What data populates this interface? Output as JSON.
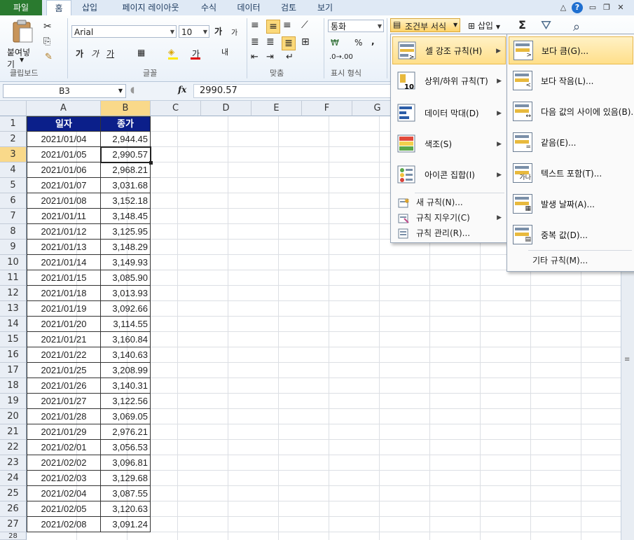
{
  "tabs": [
    "파일",
    "홈",
    "삽입",
    "페이지 레이아웃",
    "수식",
    "데이터",
    "검토",
    "보기"
  ],
  "ribbon": {
    "paste_label": "붙여넣기",
    "font_name": "Arial",
    "font_size": "10",
    "increase_font": "가",
    "decrease_font": "가",
    "bold": "가",
    "italic": "가",
    "underline": "가",
    "wrap": "내",
    "number_format": "통화",
    "percent": "%",
    "comma": ",",
    "conditional_format": "조건부 서식",
    "insert": "삽입",
    "sum": "Σ",
    "groups": {
      "clipboard": "클립보드",
      "font": "글꼴",
      "align": "맞춤",
      "number": "표시 형식"
    }
  },
  "formula_bar": {
    "name_box": "B3",
    "fx": "fx",
    "value": "2990.57"
  },
  "columns": [
    "A",
    "B",
    "C",
    "D",
    "E",
    "F",
    "G"
  ],
  "header_row": {
    "a": "일자",
    "b": "종가"
  },
  "rows": [
    {
      "n": "2",
      "date": "2021/01/04",
      "close": "2,944.45"
    },
    {
      "n": "3",
      "date": "2021/01/05",
      "close": "2,990.57"
    },
    {
      "n": "4",
      "date": "2021/01/06",
      "close": "2,968.21"
    },
    {
      "n": "5",
      "date": "2021/01/07",
      "close": "3,031.68"
    },
    {
      "n": "6",
      "date": "2021/01/08",
      "close": "3,152.18"
    },
    {
      "n": "7",
      "date": "2021/01/11",
      "close": "3,148.45"
    },
    {
      "n": "8",
      "date": "2021/01/12",
      "close": "3,125.95"
    },
    {
      "n": "9",
      "date": "2021/01/13",
      "close": "3,148.29"
    },
    {
      "n": "10",
      "date": "2021/01/14",
      "close": "3,149.93"
    },
    {
      "n": "11",
      "date": "2021/01/15",
      "close": "3,085.90"
    },
    {
      "n": "12",
      "date": "2021/01/18",
      "close": "3,013.93"
    },
    {
      "n": "13",
      "date": "2021/01/19",
      "close": "3,092.66"
    },
    {
      "n": "14",
      "date": "2021/01/20",
      "close": "3,114.55"
    },
    {
      "n": "15",
      "date": "2021/01/21",
      "close": "3,160.84"
    },
    {
      "n": "16",
      "date": "2021/01/22",
      "close": "3,140.63"
    },
    {
      "n": "17",
      "date": "2021/01/25",
      "close": "3,208.99"
    },
    {
      "n": "18",
      "date": "2021/01/26",
      "close": "3,140.31"
    },
    {
      "n": "19",
      "date": "2021/01/27",
      "close": "3,122.56"
    },
    {
      "n": "20",
      "date": "2021/01/28",
      "close": "3,069.05"
    },
    {
      "n": "21",
      "date": "2021/01/29",
      "close": "2,976.21"
    },
    {
      "n": "22",
      "date": "2021/02/01",
      "close": "3,056.53"
    },
    {
      "n": "23",
      "date": "2021/02/02",
      "close": "3,096.81"
    },
    {
      "n": "24",
      "date": "2021/02/03",
      "close": "3,129.68"
    },
    {
      "n": "25",
      "date": "2021/02/04",
      "close": "3,087.55"
    },
    {
      "n": "26",
      "date": "2021/02/05",
      "close": "3,120.63"
    },
    {
      "n": "27",
      "date": "2021/02/08",
      "close": "3,091.24"
    }
  ],
  "last_row_number": "28",
  "menu_main": [
    "셀 강조 규칙(H)",
    "상위/하위 규칙(T)",
    "데이터 막대(D)",
    "색조(S)",
    "아이콘 집합(I)"
  ],
  "menu_small": [
    "새 규칙(N)...",
    "규칙 지우기(C)",
    "규칙 관리(R)..."
  ],
  "submenu": [
    "보다 큼(G)...",
    "보다 작음(L)...",
    "다음 값의 사이에 있음(B)...",
    "같음(E)...",
    "텍스트 포함(T)...",
    "발생 날짜(A)...",
    "중복 값(D)..."
  ],
  "submenu_more": "기타 규칙(M)...",
  "colors": {
    "header_fill": "#0b1f8a",
    "file_tab": "#2a7a2f",
    "highlight": "#ffdf8a"
  }
}
